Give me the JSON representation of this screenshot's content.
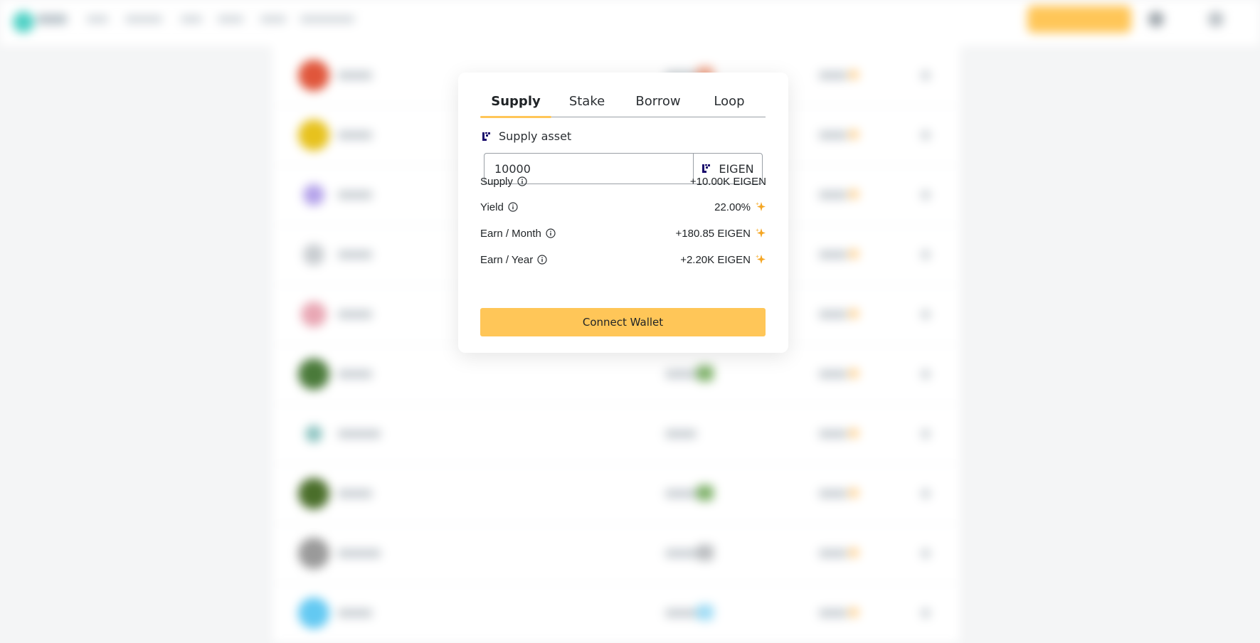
{
  "colors": {
    "accent": "#ffc658",
    "eigen_brand": "#1a0c6d",
    "sparkle": "#f5a623"
  },
  "modal": {
    "tabs": [
      {
        "label": "Supply",
        "active": true
      },
      {
        "label": "Stake",
        "active": false
      },
      {
        "label": "Borrow",
        "active": false
      },
      {
        "label": "Loop",
        "active": false
      }
    ],
    "supply_asset": {
      "icon": "eigen-logo-icon",
      "label": "Supply asset"
    },
    "amount_input": {
      "value": "10000"
    },
    "token_select": {
      "icon": "eigen-logo-icon",
      "label": "EIGEN"
    },
    "stats": [
      {
        "label": "Supply",
        "value": "+10.00K EIGEN",
        "sparkle": false
      },
      {
        "label": "Yield",
        "value": "22.00%",
        "sparkle": true
      },
      {
        "label": "Earn / Month",
        "value": "+180.85 EIGEN",
        "sparkle": true
      },
      {
        "label": "Earn / Year",
        "value": "+2.20K EIGEN",
        "sparkle": true
      }
    ],
    "connect_button": {
      "label": "Connect Wallet"
    }
  }
}
